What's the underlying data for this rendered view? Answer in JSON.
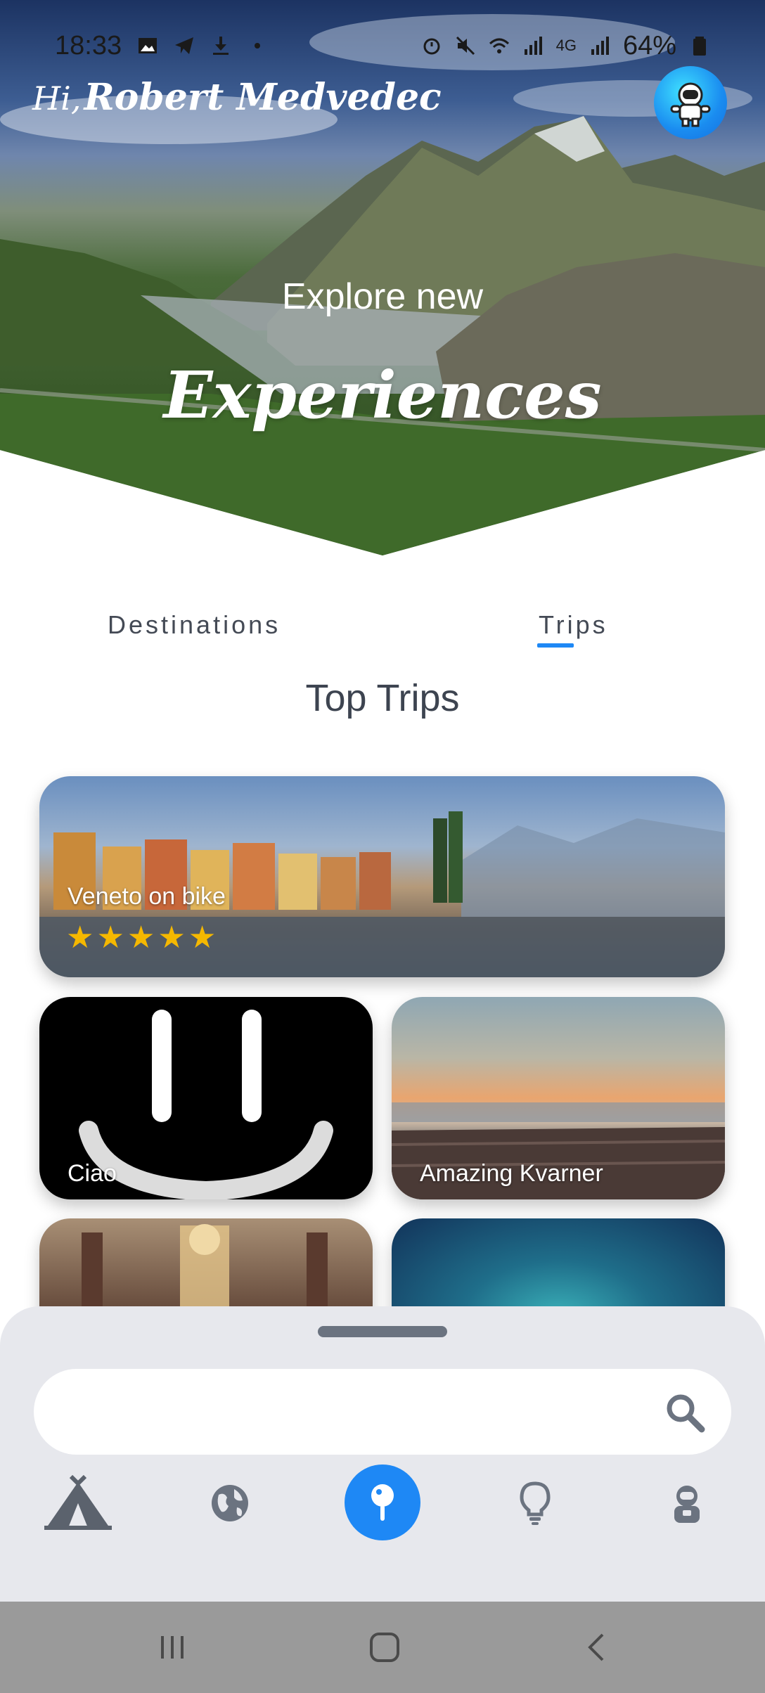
{
  "status_bar": {
    "time": "18:33",
    "battery": "64%",
    "network": "4G"
  },
  "header": {
    "greeting_prefix": "Hi,",
    "user_name": "Robert Medvedec",
    "avatar_icon": "astronaut-icon"
  },
  "hero": {
    "subtitle": "Explore new",
    "title": "Experiences"
  },
  "tabs": [
    {
      "label": "Destinations",
      "active": false
    },
    {
      "label": "Trips",
      "active": true
    }
  ],
  "section": {
    "title": "Top Trips"
  },
  "trips": [
    {
      "name": "Veneto on bike",
      "rating": 5
    },
    {
      "name": "Ciao",
      "rating": null
    },
    {
      "name": "Amazing Kvarner",
      "rating": null
    },
    {
      "name": "",
      "rating": null
    },
    {
      "name": "",
      "rating": null
    }
  ],
  "search": {
    "placeholder": "",
    "value": ""
  },
  "bottom_nav": [
    {
      "icon": "tent-icon",
      "active": false
    },
    {
      "icon": "globe-icon",
      "active": false
    },
    {
      "icon": "map-pin-icon",
      "active": true
    },
    {
      "icon": "lightbulb-icon",
      "active": false
    },
    {
      "icon": "astronaut-icon",
      "active": false
    }
  ],
  "colors": {
    "accent": "#1e88f5",
    "star": "#f5b800",
    "sheet": "#e7e8ed"
  }
}
